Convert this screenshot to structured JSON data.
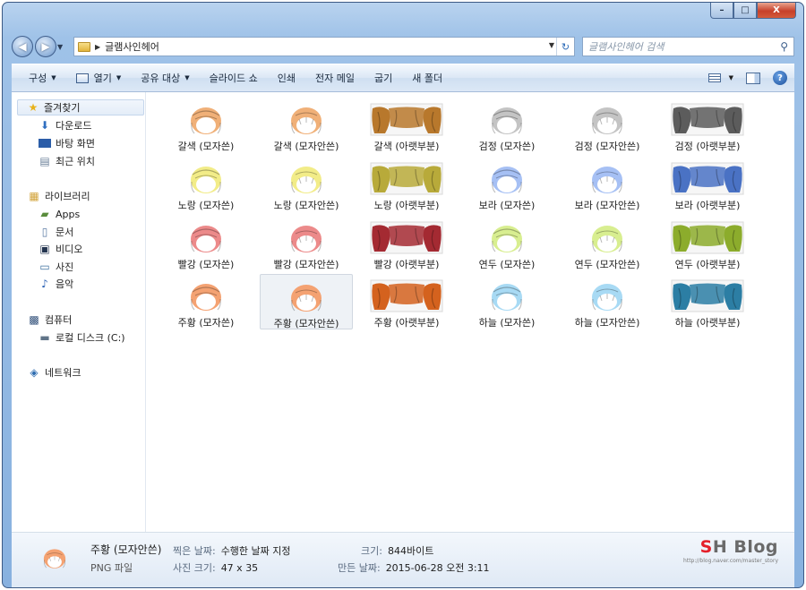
{
  "window": {
    "caption_buttons": [
      "–",
      "□",
      "X"
    ]
  },
  "address": {
    "path": "글램사인헤어",
    "search_placeholder": "글램사인헤어 검색"
  },
  "toolbar": {
    "organize": "구성",
    "open": "열기",
    "share": "공유 대상",
    "slideshow": "슬라이드 쇼",
    "print": "인쇄",
    "email": "전자 메일",
    "burn": "굽기",
    "new_folder": "새 폴더"
  },
  "nav": {
    "favorites": "즐겨찾기",
    "downloads": "다운로드",
    "desktop": "바탕 화면",
    "recent": "최근 위치",
    "libraries": "라이브러리",
    "apps": "Apps",
    "documents": "문서",
    "videos": "비디오",
    "pictures": "사진",
    "music": "음악",
    "computer": "컴퓨터",
    "local_disk": "로컬 디스크 (C:)",
    "network": "네트워크"
  },
  "files": [
    {
      "label": "갈색 (모자쓴)",
      "color": "#f0b078",
      "style": "hat"
    },
    {
      "label": "갈색 (모자안쓴)",
      "color": "#f0b078",
      "style": "nohat"
    },
    {
      "label": "갈색 (아랫부분)",
      "color": "#b8782c",
      "style": "bottom"
    },
    {
      "label": "검정 (모자쓴)",
      "color": "#c4c4c4",
      "style": "hat"
    },
    {
      "label": "검정 (모자안쓴)",
      "color": "#c4c4c4",
      "style": "nohat"
    },
    {
      "label": "검정 (아랫부분)",
      "color": "#5c5c5c",
      "style": "bottom"
    },
    {
      "label": "노랑 (모자쓴)",
      "color": "#f2ec88",
      "style": "hat"
    },
    {
      "label": "노랑 (모자안쓴)",
      "color": "#f2ec88",
      "style": "nohat"
    },
    {
      "label": "노랑 (아랫부분)",
      "color": "#b8aa3a",
      "style": "bottom"
    },
    {
      "label": "보라 (모자쓴)",
      "color": "#a6c0f4",
      "style": "hat"
    },
    {
      "label": "보라 (모자안쓴)",
      "color": "#a6c0f4",
      "style": "nohat"
    },
    {
      "label": "보라 (아랫부분)",
      "color": "#4a72c4",
      "style": "bottom"
    },
    {
      "label": "빨강 (모자쓴)",
      "color": "#ec8a8a",
      "style": "hat"
    },
    {
      "label": "빨강 (모자안쓴)",
      "color": "#ec8a8a",
      "style": "nohat"
    },
    {
      "label": "빨강 (아랫부분)",
      "color": "#a42a32",
      "style": "bottom"
    },
    {
      "label": "연두 (모자쓴)",
      "color": "#d8ee90",
      "style": "hat"
    },
    {
      "label": "연두 (모자안쓴)",
      "color": "#d8ee90",
      "style": "nohat"
    },
    {
      "label": "연두 (아랫부분)",
      "color": "#8cac2c",
      "style": "bottom"
    },
    {
      "label": "주황 (모자쓴)",
      "color": "#f4a272",
      "style": "hat"
    },
    {
      "label": "주황 (모자안쓴)",
      "color": "#f4a272",
      "style": "nohat",
      "selected": true
    },
    {
      "label": "주황 (아랫부분)",
      "color": "#d4621e",
      "style": "bottom"
    },
    {
      "label": "하늘 (모자쓴)",
      "color": "#a8daf4",
      "style": "hat"
    },
    {
      "label": "하늘 (모자안쓴)",
      "color": "#a8daf4",
      "style": "nohat"
    },
    {
      "label": "하늘 (아랫부분)",
      "color": "#2c7ea4",
      "style": "bottom"
    }
  ],
  "details": {
    "name": "주황 (모자안쓴)",
    "type": "PNG 파일",
    "date_taken_key": "찍은 날짜:",
    "date_taken_val": "수행한 날짜 지정",
    "dimensions_key": "사진 크기:",
    "dimensions_val": "47 x 35",
    "size_key": "크기:",
    "size_val": "844바이트",
    "modified_key": "만든 날짜:",
    "modified_val": "2015-06-28 오전 3:11",
    "thumb_color": "#f4a272"
  },
  "logo": {
    "brand_s": "S",
    "brand_rest": "H Blog",
    "url": "http://blog.naver.com/master_story"
  }
}
